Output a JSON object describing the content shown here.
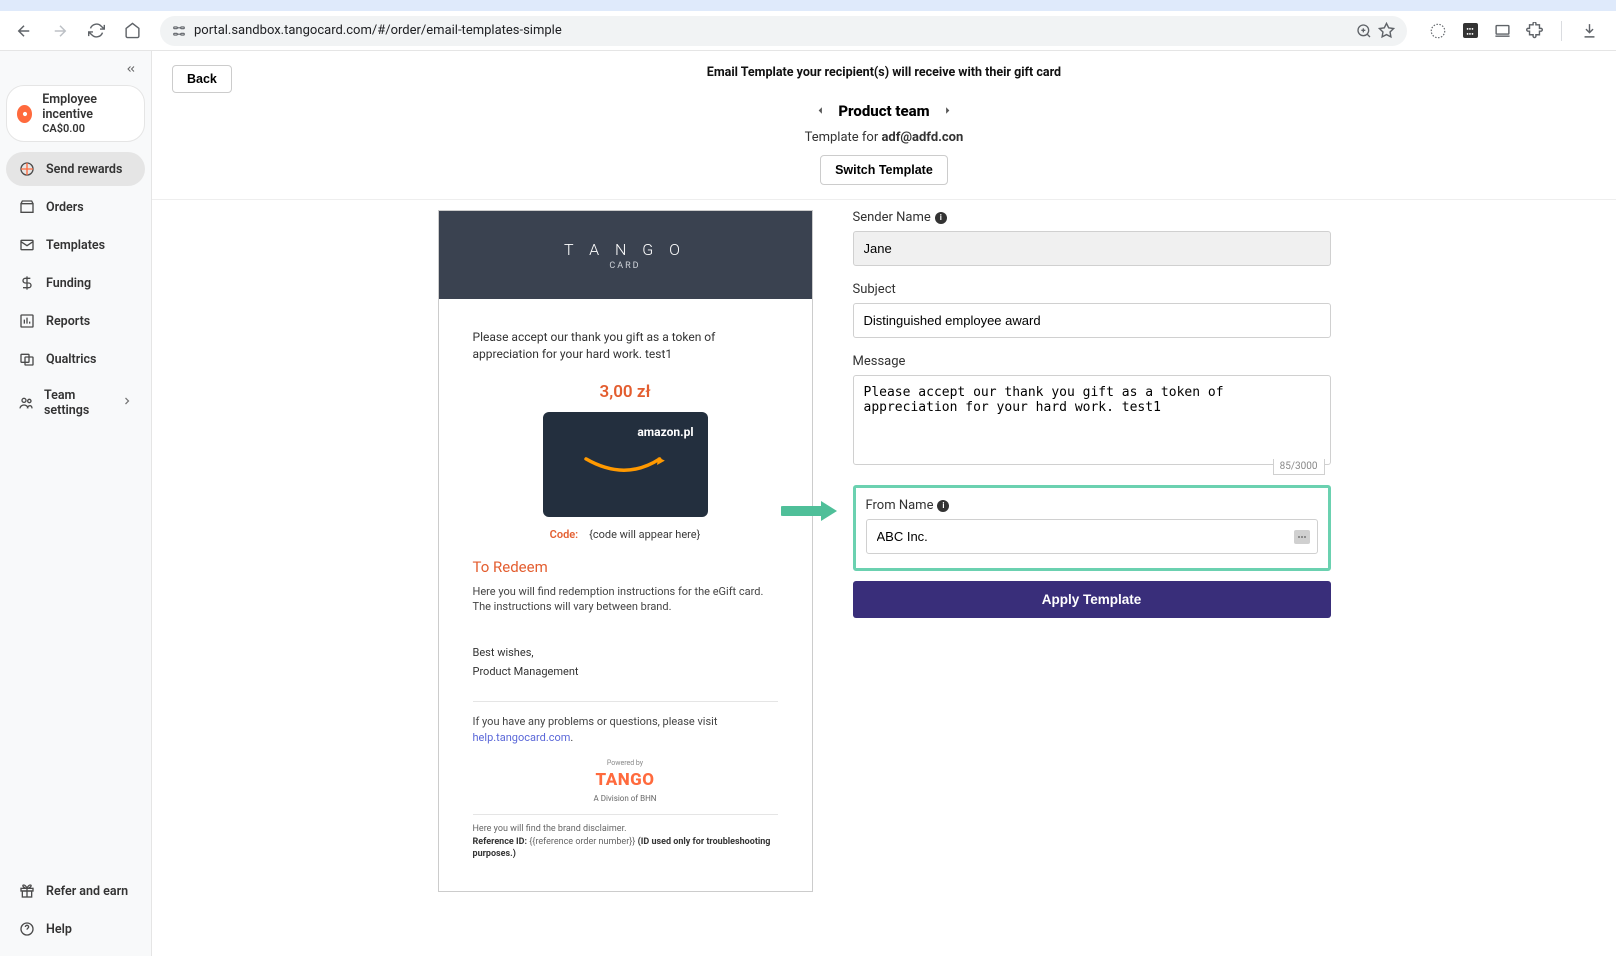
{
  "browser": {
    "url": "portal.sandbox.tangocard.com/#/order/email-templates-simple"
  },
  "sidebar": {
    "collapse_icon": "«",
    "pill_title": "Employee incentive",
    "pill_sub": "CA$0.00",
    "items": [
      {
        "label": "Send rewards"
      },
      {
        "label": "Orders"
      },
      {
        "label": "Templates"
      },
      {
        "label": "Funding"
      },
      {
        "label": "Reports"
      },
      {
        "label": "Qualtrics"
      },
      {
        "label": "Team settings"
      }
    ],
    "footer": [
      {
        "label": "Refer and earn"
      },
      {
        "label": "Help"
      }
    ]
  },
  "topbar": {
    "back": "Back",
    "heading": "Email Template your recipient(s) will receive with their gift card",
    "team": "Product team",
    "template_for_prefix": "Template for ",
    "template_for_email": "adf@adfd.con",
    "switch": "Switch Template"
  },
  "preview": {
    "logo_main": "T A N G O",
    "logo_sub": "CARD",
    "message": "Please accept our thank you gift as a token of appreciation for your hard work. test1",
    "price": "3,00 zł",
    "card_brand": "amazon.pl",
    "code_label": "Code:",
    "code_value": "{code will appear here}",
    "redeem_title": "To Redeem",
    "redeem_text": "Here you will find redemption instructions for the eGift card. The instructions will vary between brand.",
    "signoff1": "Best wishes,",
    "signoff2": "Product Management",
    "help_text_prefix": "If you have any problems or questions, please visit ",
    "help_link": "help.tangocard.com",
    "help_text_suffix": ".",
    "footer_logo": "TANGO",
    "footer_powered": "Powered by",
    "footer_division": "A Division of BHN",
    "disclaimer1": "Here you will find the brand disclaimer.",
    "disclaimer2_label": "Reference ID: ",
    "disclaimer2a": "{{reference order number}} ",
    "disclaimer2b": "(ID used only for troubleshooting purposes.)"
  },
  "form": {
    "sender_label": "Sender Name",
    "sender_value": "Jane",
    "subject_label": "Subject",
    "subject_value": "Distinguished employee award",
    "message_label": "Message",
    "message_value": "Please accept our thank you gift as a token of appreciation for your hard work. test1",
    "message_count": "85/3000",
    "from_label": "From Name",
    "from_value": "ABC Inc.",
    "apply": "Apply Template"
  }
}
